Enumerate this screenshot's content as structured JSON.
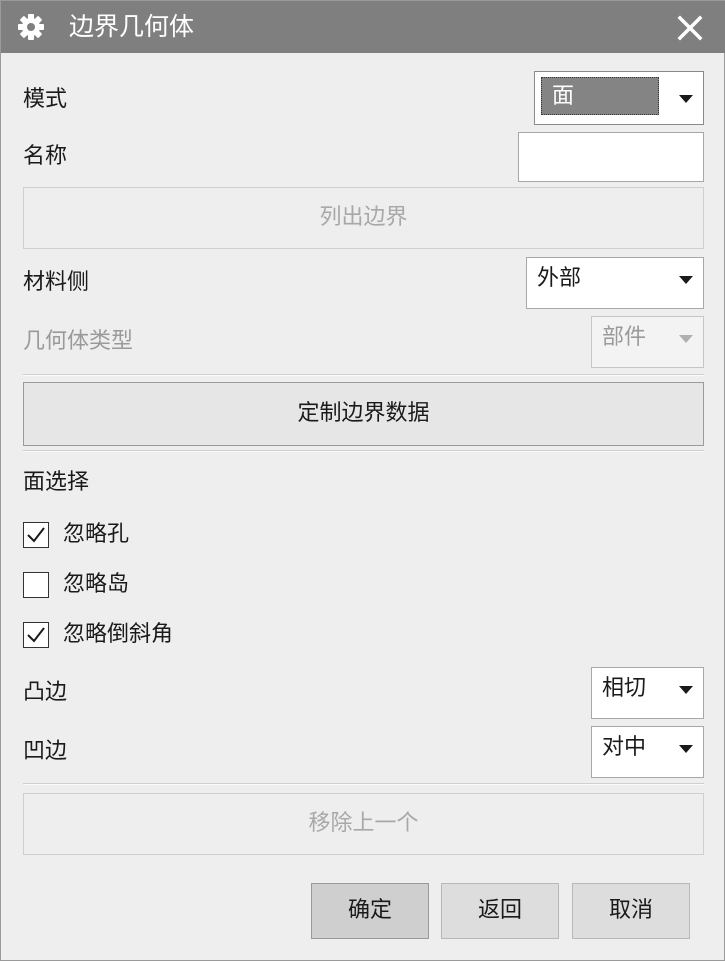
{
  "window": {
    "title": "边界几何体",
    "icon": "gear-icon",
    "close_icon": "close-icon"
  },
  "mode": {
    "label": "模式",
    "value": "面"
  },
  "name": {
    "label": "名称",
    "value": ""
  },
  "list_boundaries_button": "列出边界",
  "material_side": {
    "label": "材料侧",
    "value": "外部"
  },
  "geometry_type": {
    "label": "几何体类型",
    "value": "部件"
  },
  "custom_boundary_data_button": "定制边界数据",
  "face_selection": {
    "heading": "面选择",
    "checkboxes": [
      {
        "label": "忽略孔",
        "checked": true
      },
      {
        "label": "忽略岛",
        "checked": false
      },
      {
        "label": "忽略倒斜角",
        "checked": true
      }
    ]
  },
  "convex_edge": {
    "label": "凸边",
    "value": "相切"
  },
  "concave_edge": {
    "label": "凹边",
    "value": "对中"
  },
  "remove_last_button": "移除上一个",
  "footer": {
    "ok": "确定",
    "back": "返回",
    "cancel": "取消"
  },
  "colors": {
    "titlebar": "#7f7f7f",
    "background": "#eeeeee",
    "disabled_text": "#9a9a9a"
  }
}
